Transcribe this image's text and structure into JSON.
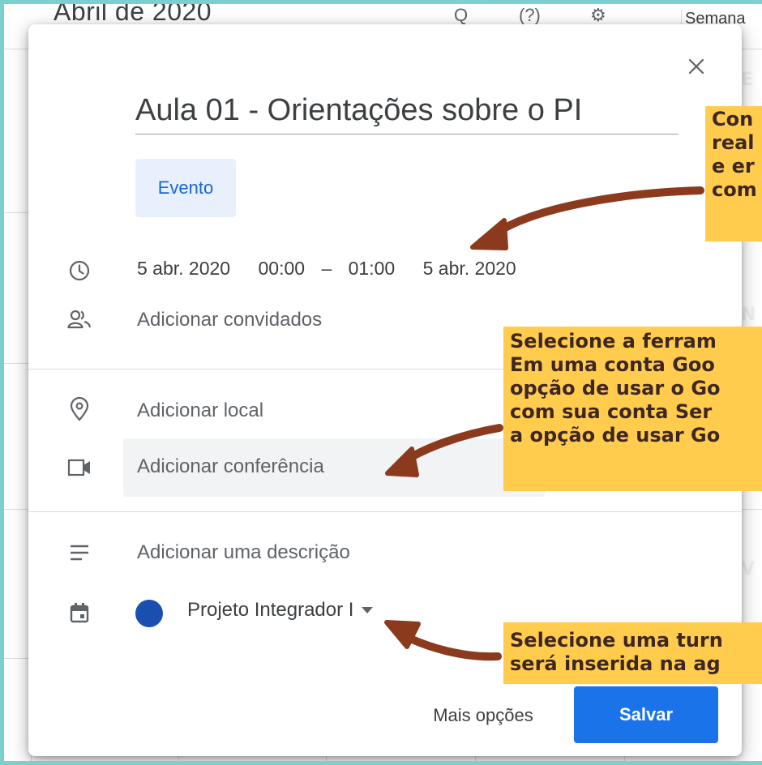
{
  "background": {
    "month_title": "Abril de 2020",
    "header_glyphs": [
      "Q",
      "(?)",
      "⚙"
    ],
    "view_label": "Semana",
    "side_letters": [
      "E",
      "N",
      "V"
    ]
  },
  "dialog": {
    "title": "Aula 01 - Orientações sobre o PI",
    "event_type": "Evento",
    "start_date": "5 abr. 2020",
    "start_time": "00:00",
    "dash": "–",
    "end_time": "01:00",
    "end_date": "5 abr. 2020",
    "add_guests": "Adicionar convidados",
    "add_location": "Adicionar local",
    "add_conference": "Adicionar conferência",
    "add_description": "Adicionar uma descrição",
    "calendar_name": "Projeto Integrador I",
    "calendar_color": "#1a4fb0",
    "more_options": "Mais opções",
    "save": "Salvar"
  },
  "icons": {
    "close": "close-icon",
    "clock": "clock-icon",
    "people": "people-icon",
    "location": "location-pin-icon",
    "video": "video-camera-icon",
    "notes": "notes-icon",
    "calendar": "calendar-icon"
  },
  "annotations": {
    "callout_1": [
      "Con",
      "real",
      "e er",
      "com"
    ],
    "callout_2": [
      "Selecione a ferram",
      "Em uma conta Goo",
      "opção de usar o Go",
      "com sua conta Ser",
      "a opção de usar Go"
    ],
    "callout_3": [
      "Selecione uma turn",
      "será inserida na ag"
    ],
    "callout_color": "#ffcc4d",
    "arrow_color": "#8b3a1e"
  },
  "colors": {
    "accent": "#1a73e8",
    "chip_bg": "#e8f0fe",
    "frame": "#7ccfcf"
  }
}
